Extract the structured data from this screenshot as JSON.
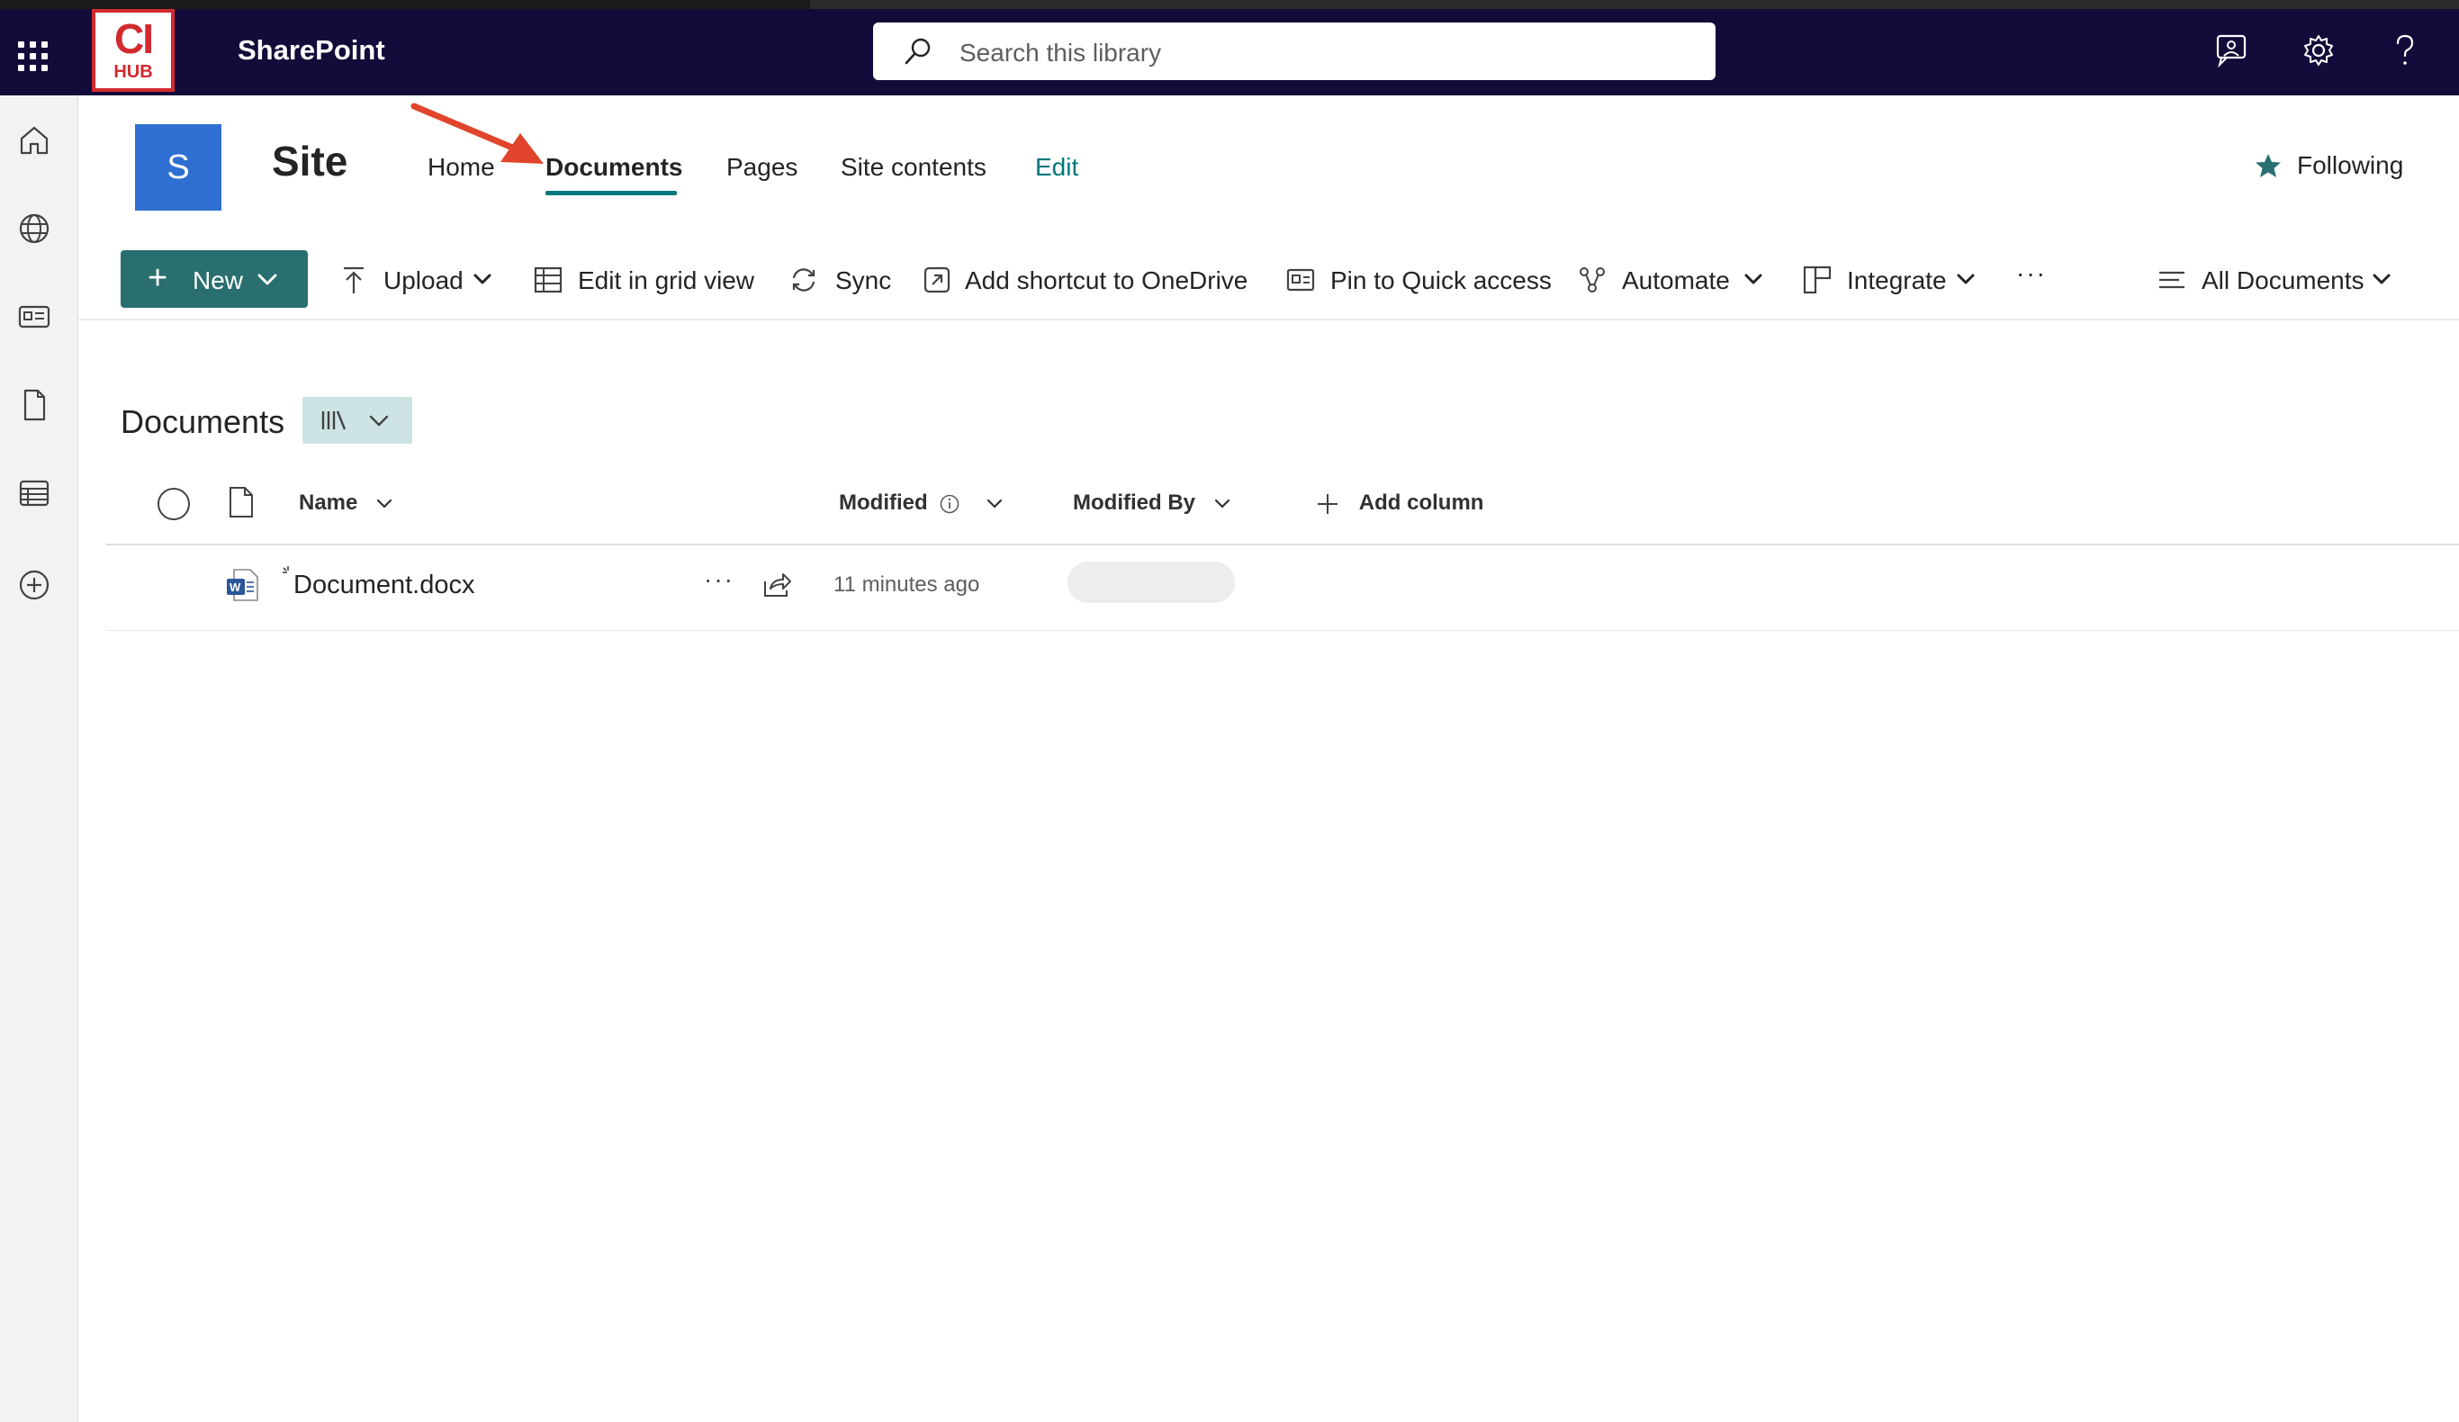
{
  "suite_bar": {
    "app_name": "SharePoint",
    "logo_text_top": "CI",
    "logo_text_bottom": "HUB",
    "search_placeholder": "Search this library",
    "icons": [
      "waffle-icon",
      "feedback-icon",
      "settings-icon",
      "help-icon"
    ]
  },
  "left_rail": {
    "icons": [
      "home-icon",
      "globe-icon",
      "news-icon",
      "file-icon",
      "list-icon",
      "add-circle-icon"
    ]
  },
  "site": {
    "logo_letter": "S",
    "name": "Site",
    "nav": [
      {
        "label": "Home",
        "active": false
      },
      {
        "label": "Documents",
        "active": true
      },
      {
        "label": "Pages",
        "active": false
      },
      {
        "label": "Site contents",
        "active": false
      },
      {
        "label": "Edit",
        "active": false
      }
    ],
    "following_label": "Following"
  },
  "command_bar": {
    "new_label": "New",
    "upload_label": "Upload",
    "grid_label": "Edit in grid view",
    "sync_label": "Sync",
    "shortcut_label": "Add shortcut to OneDrive",
    "pin_label": "Pin to Quick access",
    "automate_label": "Automate",
    "integrate_label": "Integrate",
    "more_label": "···",
    "view_label": "All Documents"
  },
  "library": {
    "title": "Documents",
    "columns": {
      "name": "Name",
      "modified": "Modified",
      "modified_by": "Modified By",
      "add_column": "Add column"
    },
    "rows": [
      {
        "name": "Document.docx",
        "modified": "11 minutes ago",
        "more": "···"
      }
    ]
  },
  "colors": {
    "suite_bar": "#130c3a",
    "accent": "#03787c",
    "new_button": "#2a6f6f",
    "site_logo": "#2f6fd1",
    "annotation_arrow": "#e0452b"
  }
}
